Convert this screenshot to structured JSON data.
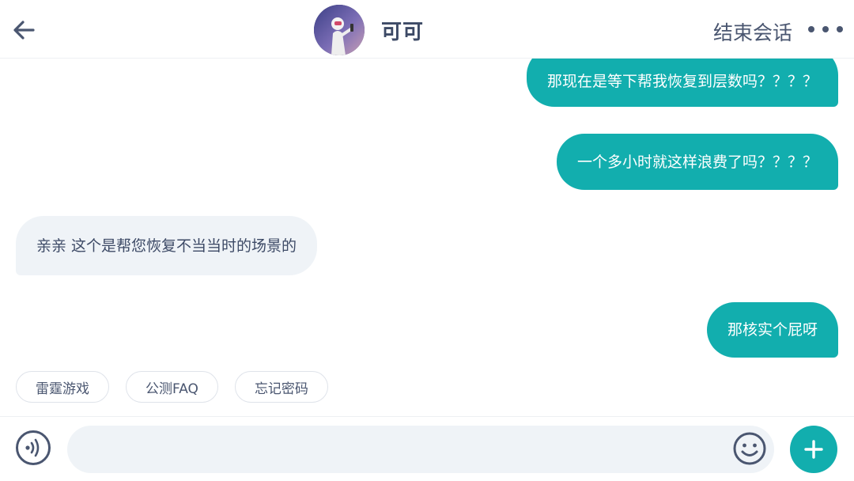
{
  "header": {
    "back_icon": "arrow-left-icon",
    "contact_name": "可可",
    "end_session_label": "结束会话",
    "more_icon": "more-dots-icon"
  },
  "messages": [
    {
      "side": "out",
      "text": "那现在是等下帮我恢复到层数吗？？？？"
    },
    {
      "side": "out",
      "text": "一个多小时就这样浪费了吗？？？？"
    },
    {
      "side": "in",
      "text": "亲亲 这个是帮您恢复不当当时的场景的"
    },
    {
      "side": "out",
      "text": "那核实个屁呀"
    }
  ],
  "quick_replies": [
    "雷霆游戏",
    "公测FAQ",
    "忘记密码"
  ],
  "input": {
    "value": "",
    "placeholder": "",
    "voice_icon": "voice-icon",
    "emoji_icon": "emoji-icon",
    "plus_icon": "plus-icon"
  },
  "colors": {
    "accent": "#12aeae",
    "incoming_bubble": "#eff3f7",
    "text": "#3d4a66"
  }
}
